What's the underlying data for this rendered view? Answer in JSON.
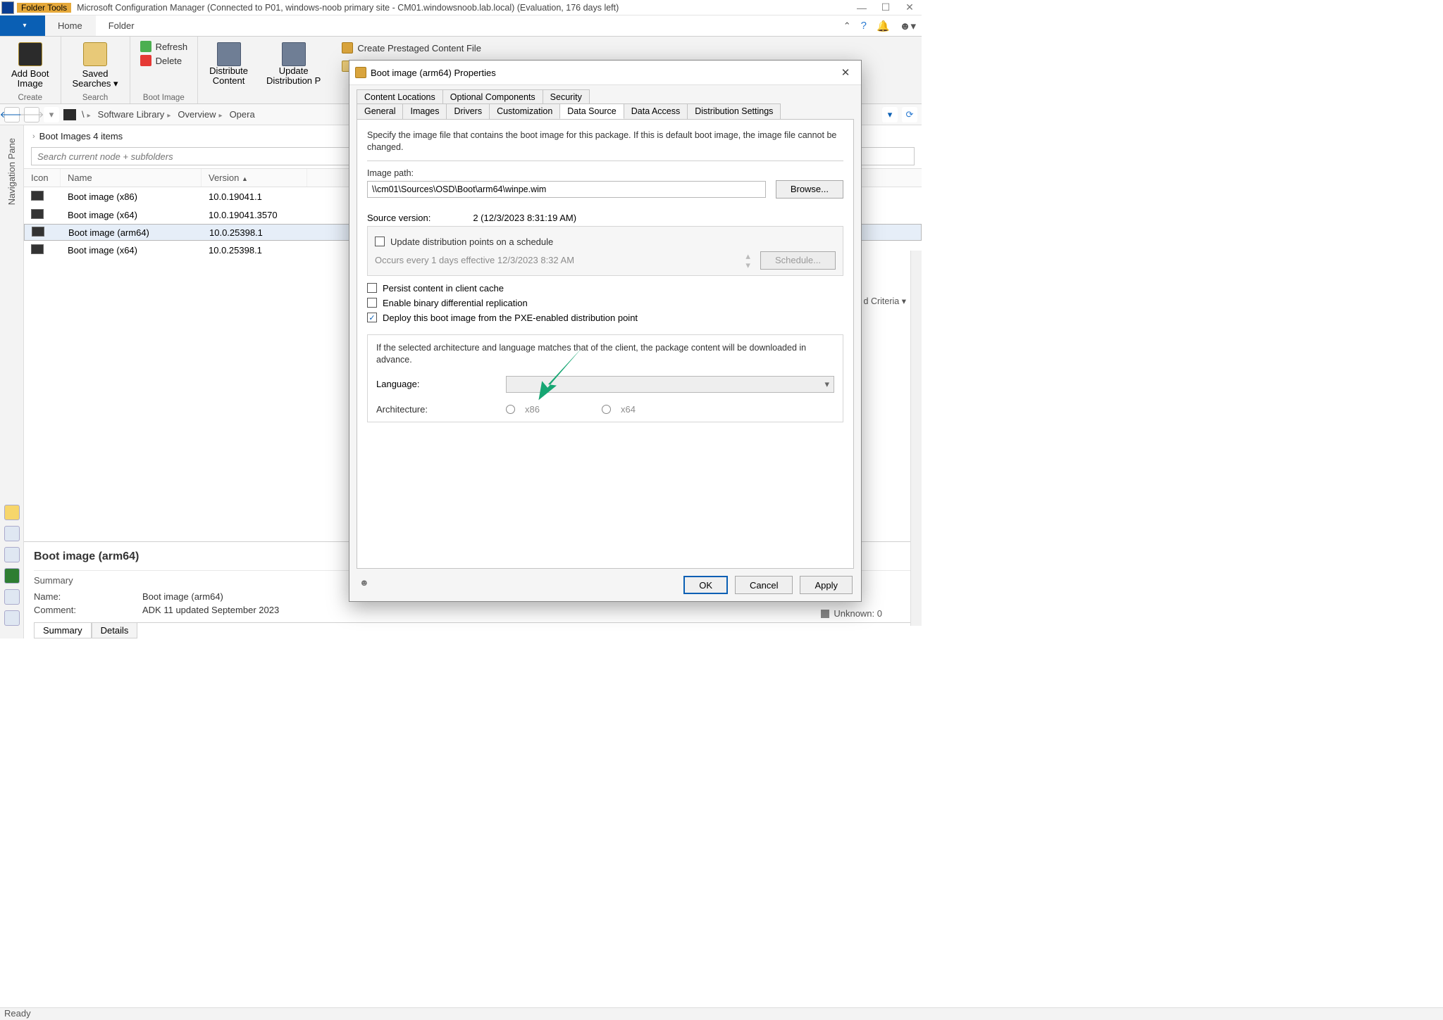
{
  "title": {
    "folder_tools": "Folder Tools",
    "app": "Microsoft Configuration Manager (Connected to P01, windows-noob primary site - CM01.windowsnoob.lab.local) (Evaluation, 176 days left)"
  },
  "menu": {
    "home": "Home",
    "folder": "Folder"
  },
  "ribbon": {
    "add_boot_image": "Add Boot\nImage",
    "create": "Create",
    "saved_searches": "Saved\nSearches ▾",
    "search": "Search",
    "refresh": "Refresh",
    "delete": "Delete",
    "boot_image_group": "Boot Image",
    "distribute_content": "Distribute\nContent",
    "update_dp": "Update\nDistribution P",
    "create_prestaged": "Create Prestaged Content File"
  },
  "breadcrumb": {
    "c1": "Software Library",
    "c2": "Overview",
    "c3": "Opera"
  },
  "node": {
    "title": "Boot Images 4 items",
    "search_placeholder": "Search current node + subfolders",
    "add_criteria": "d Criteria ▾"
  },
  "list": {
    "cols": {
      "icon": "Icon",
      "name": "Name",
      "version": "Version"
    },
    "rows": [
      {
        "name": "Boot image (x86)",
        "version": "10.0.19041.1"
      },
      {
        "name": "Boot image (x64)",
        "version": "10.0.19041.3570"
      },
      {
        "name": "Boot image (arm64)",
        "version": "10.0.25398.1"
      },
      {
        "name": "Boot image (x64)",
        "version": "10.0.25398.1"
      }
    ],
    "selected_index": 2
  },
  "detail": {
    "title": "Boot image (arm64)",
    "summary_label": "Summary",
    "name_k": "Name:",
    "name_v": "Boot image (arm64)",
    "comment_k": "Comment:",
    "comment_v": "ADK 11 updated September 2023",
    "tab_summary": "Summary",
    "tab_details": "Details",
    "unknown": "Unknown: 0"
  },
  "statusbar": {
    "ready": "Ready"
  },
  "dialog": {
    "title": "Boot image (arm64) Properties",
    "tabs_row1": [
      "Content Locations",
      "Optional Components",
      "Security"
    ],
    "tabs_row2": [
      "General",
      "Images",
      "Drivers",
      "Customization",
      "Data Source",
      "Data Access",
      "Distribution Settings"
    ],
    "active_tab": "Data Source",
    "intro": "Specify the image file that contains the boot image for this package. If this is default boot image, the image file cannot be changed.",
    "image_path_label": "Image path:",
    "image_path": "\\\\cm01\\Sources\\OSD\\Boot\\arm64\\winpe.wim",
    "browse": "Browse...",
    "source_version_label": "Source version:",
    "source_version": "2 (12/3/2023 8:31:19 AM)",
    "update_schedule_chk": "Update distribution points on a schedule",
    "schedule_text": "Occurs every 1 days effective 12/3/2023 8:32 AM",
    "schedule_btn": "Schedule...",
    "persist_chk": "Persist content in client cache",
    "binary_chk": "Enable binary differential replication",
    "pxe_chk": "Deploy this boot image from the PXE-enabled distribution point",
    "lang_note": "If the selected architecture and language matches that of the client, the package content will be downloaded in advance.",
    "language_label": "Language:",
    "arch_label": "Architecture:",
    "arch_x86": "x86",
    "arch_x64": "x64",
    "ok": "OK",
    "cancel": "Cancel",
    "apply": "Apply"
  }
}
